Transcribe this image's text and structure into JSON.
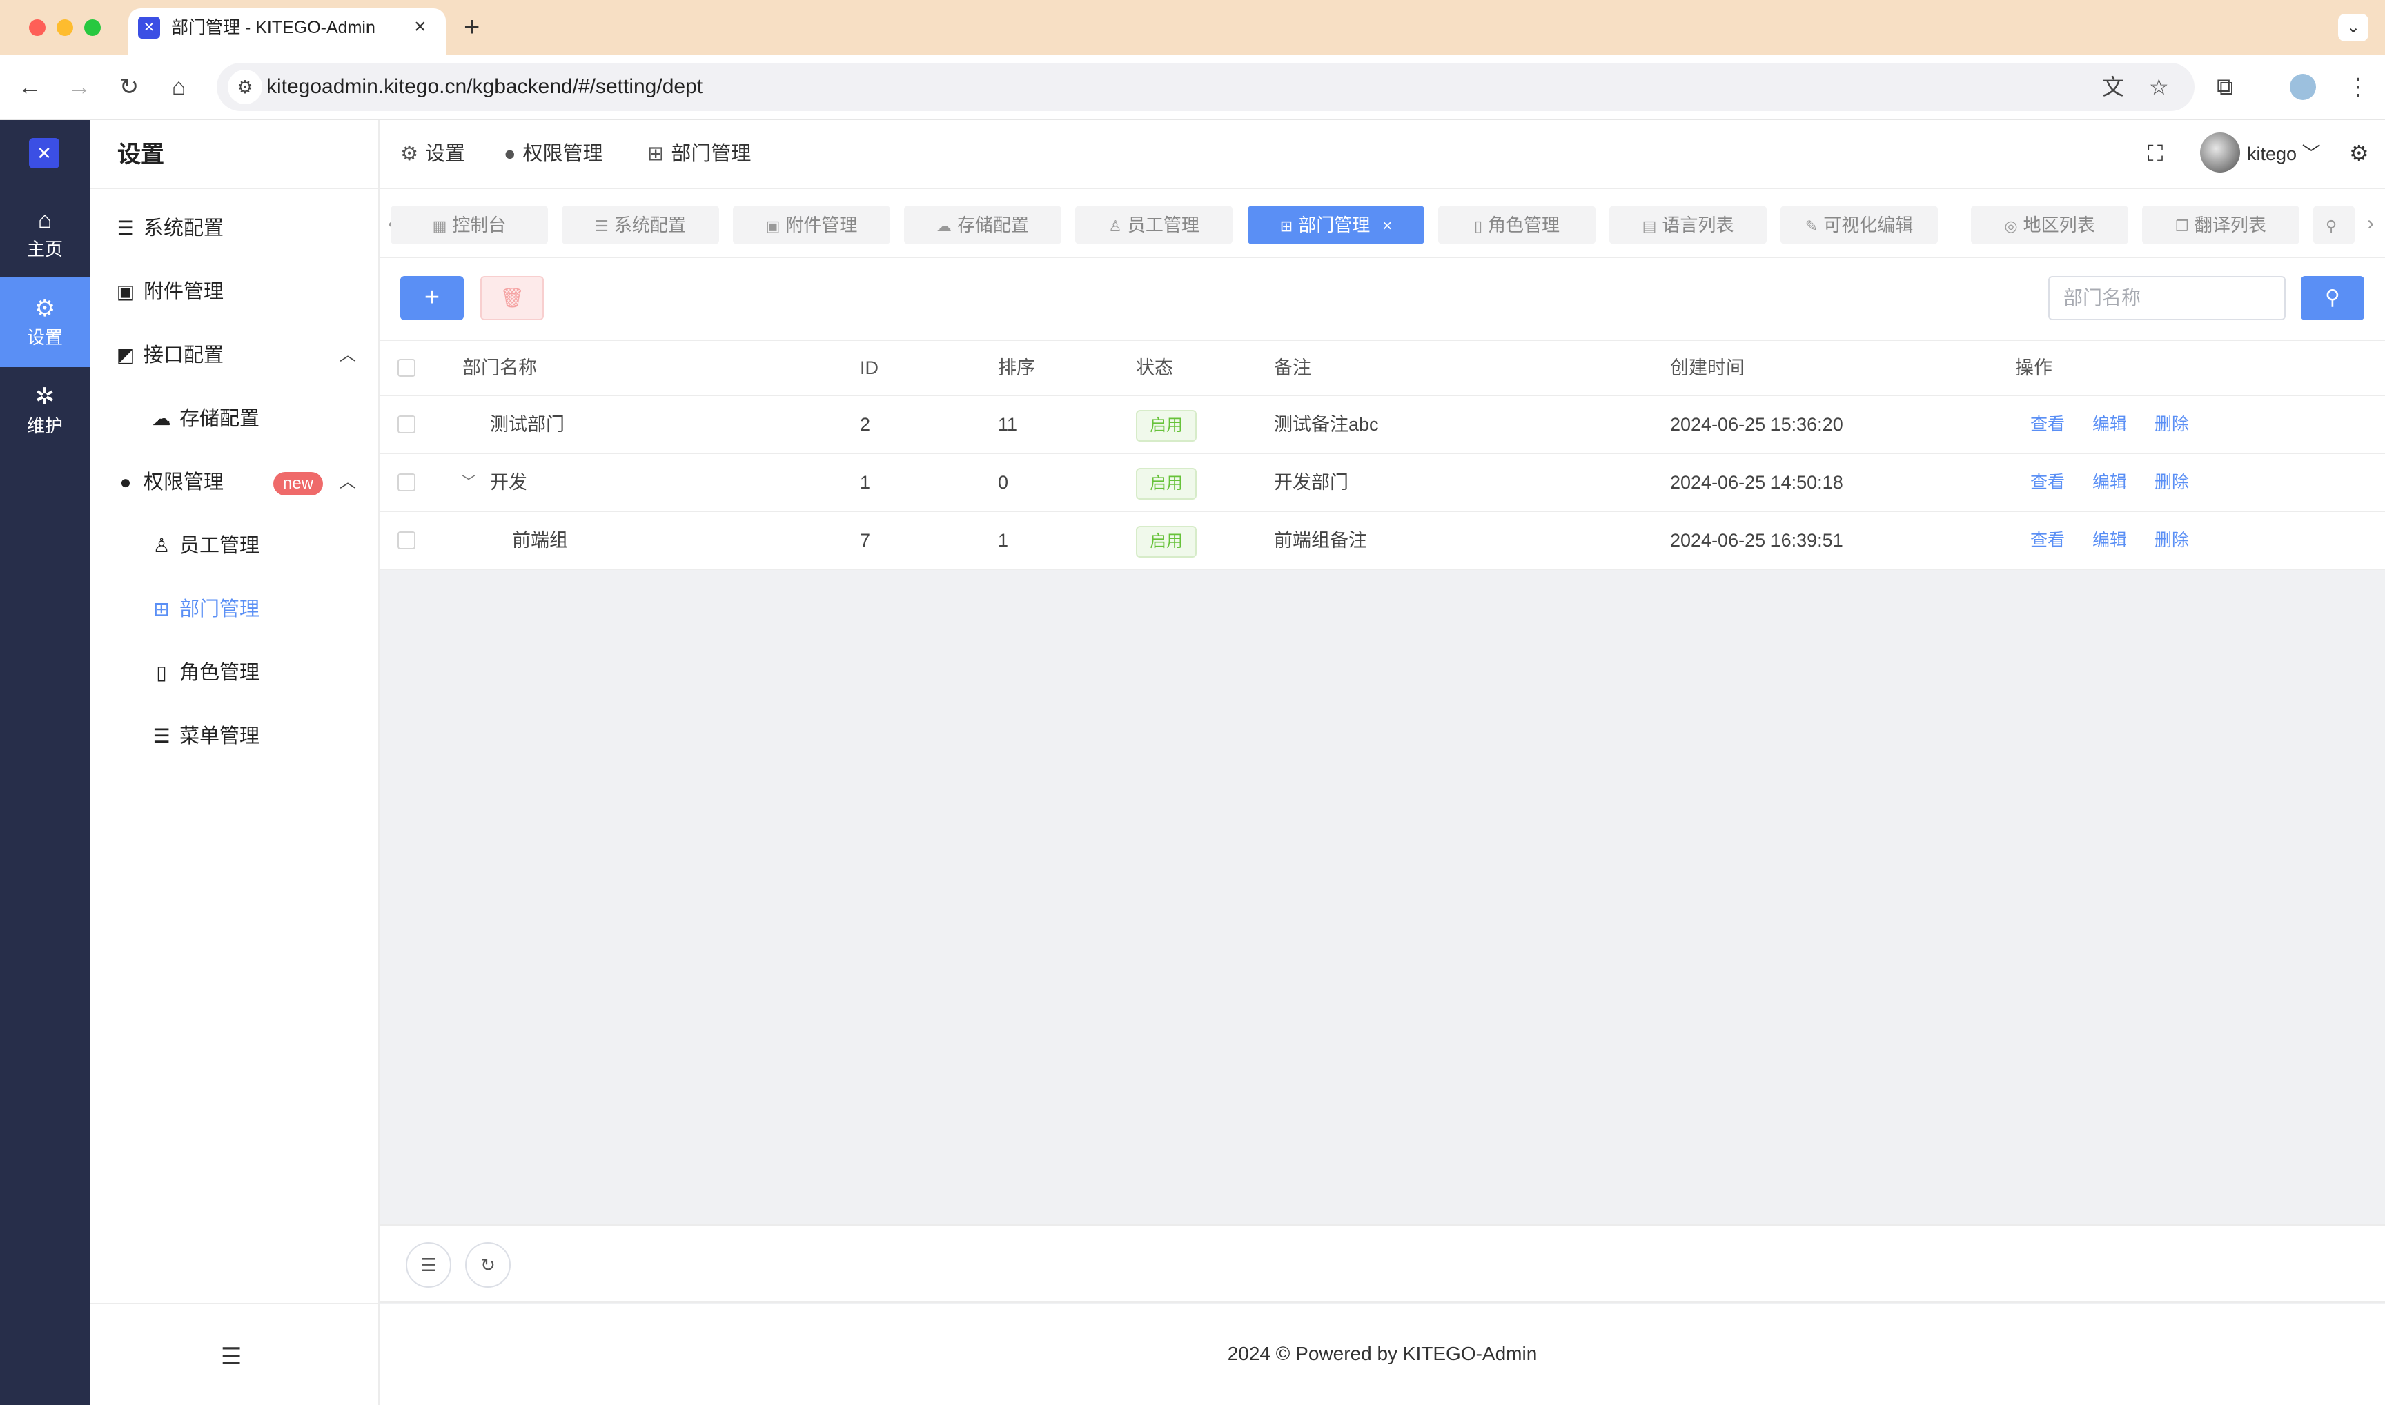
{
  "browser": {
    "tab_title": "部门管理 - KITEGO-Admin",
    "tab_close": "×",
    "new_tab": "+",
    "url": "kitegoadmin.kitego.cn/kgbackend/#/setting/dept"
  },
  "rail": {
    "items": [
      {
        "label": "主页",
        "icon": "home-icon"
      },
      {
        "label": "设置",
        "icon": "gear-icon"
      },
      {
        "label": "维护",
        "icon": "bug-icon"
      }
    ]
  },
  "menu": {
    "title": "设置",
    "items": [
      {
        "label": "系统配置",
        "icon": "sliders-icon"
      },
      {
        "label": "附件管理",
        "icon": "image-icon"
      },
      {
        "label": "接口配置",
        "icon": "chart-icon"
      },
      {
        "label": "存储配置",
        "icon": "cloud-icon"
      },
      {
        "label": "权限管理",
        "icon": "user-icon",
        "badge": "new"
      },
      {
        "label": "员工管理",
        "icon": "person-icon"
      },
      {
        "label": "部门管理",
        "icon": "org-icon"
      },
      {
        "label": "角色管理",
        "icon": "book-icon"
      },
      {
        "label": "菜单管理",
        "icon": "list-icon"
      }
    ]
  },
  "breadcrumb": [
    "设置",
    "权限管理",
    "部门管理"
  ],
  "user": {
    "name": "kitego"
  },
  "tags": [
    {
      "label": "控制台"
    },
    {
      "label": "系统配置"
    },
    {
      "label": "附件管理"
    },
    {
      "label": "存储配置"
    },
    {
      "label": "员工管理"
    },
    {
      "label": "部门管理",
      "active": true,
      "close": "×"
    },
    {
      "label": "角色管理"
    },
    {
      "label": "语言列表"
    },
    {
      "label": "可视化编辑"
    },
    {
      "label": "地区列表"
    },
    {
      "label": "翻译列表"
    }
  ],
  "search": {
    "placeholder": "部门名称"
  },
  "table": {
    "columns": [
      "部门名称",
      "ID",
      "排序",
      "状态",
      "备注",
      "创建时间",
      "操作"
    ],
    "rows": [
      {
        "name": "测试部门",
        "id": "2",
        "sort": "11",
        "status": "启用",
        "remark": "测试备注abc",
        "created": "2024-06-25 15:36:20"
      },
      {
        "name": "开发",
        "id": "1",
        "sort": "0",
        "status": "启用",
        "remark": "开发部门",
        "created": "2024-06-25 14:50:18"
      },
      {
        "name": "前端组",
        "id": "7",
        "sort": "1",
        "status": "启用",
        "remark": "前端组备注",
        "created": "2024-06-25 16:39:51"
      }
    ],
    "actions": {
      "view": "查看",
      "edit": "编辑",
      "delete": "删除"
    }
  },
  "footer": {
    "text": "2024 © Powered by  KITEGO-Admin"
  },
  "colors": {
    "primary": "#5a8ff5",
    "rail_bg": "#272e4a",
    "success": "#67c23a",
    "danger": "#ef6a6a"
  }
}
